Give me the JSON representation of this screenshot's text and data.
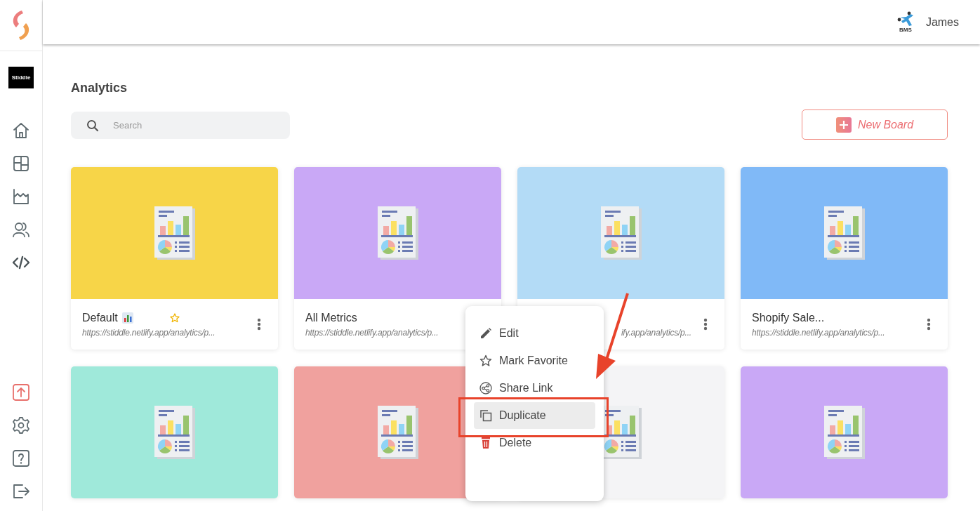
{
  "sidebar": {
    "brand": "Stiddle"
  },
  "header": {
    "user": {
      "badge": "BMS",
      "name": "James"
    }
  },
  "page": {
    "title": "Analytics"
  },
  "search": {
    "placeholder": "Search"
  },
  "new_board_button": {
    "label": "New Board"
  },
  "boards": [
    {
      "title": "Default",
      "chart_badge": true,
      "favorite": true,
      "url": "https://stiddle.netlify.app/analytics/p...",
      "color": "#f7d548"
    },
    {
      "title": "All Metrics",
      "url": "https://stiddle.netlify.app/analytics/p...",
      "menu_covered": true,
      "color": "#c9a8f6"
    },
    {
      "url": "ify.app/analytics/p...",
      "url_clipped": true,
      "color": "#b3dbf6"
    },
    {
      "title": "Shopify Sale...",
      "url": "https://stiddle.netlify.app/analytics/p...",
      "color": "#80b9f7"
    },
    {
      "color": "#9fe9da"
    },
    {
      "color": "#f0a19e"
    },
    {
      "color": "#f4f4f6"
    },
    {
      "color": "#c9a8f6"
    }
  ],
  "context_menu": {
    "items": [
      {
        "label": "Edit",
        "selected": false
      },
      {
        "label": "Mark Favorite",
        "selected": false
      },
      {
        "label": "Share Link",
        "selected": false
      },
      {
        "label": "Duplicate",
        "selected": true
      },
      {
        "label": "Delete",
        "selected": false
      }
    ]
  }
}
